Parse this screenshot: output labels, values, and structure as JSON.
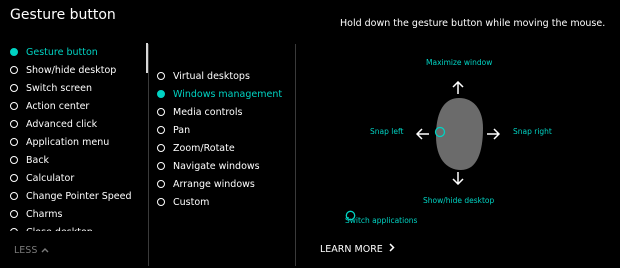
{
  "header": {
    "title": "Gesture button",
    "instruction": "Hold down the gesture button while moving the mouse."
  },
  "left_list": {
    "items": [
      {
        "label": "Gesture button",
        "active": true
      },
      {
        "label": "Show/hide desktop",
        "active": false
      },
      {
        "label": "Switch screen",
        "active": false
      },
      {
        "label": "Action center",
        "active": false
      },
      {
        "label": "Advanced click",
        "active": false
      },
      {
        "label": "Application menu",
        "active": false
      },
      {
        "label": "Back",
        "active": false
      },
      {
        "label": "Calculator",
        "active": false
      },
      {
        "label": "Change Pointer Speed",
        "active": false
      },
      {
        "label": "Charms",
        "active": false
      },
      {
        "label": "Close desktop",
        "active": false
      }
    ]
  },
  "mode_list": {
    "items": [
      {
        "label": "Virtual desktops",
        "active": false
      },
      {
        "label": "Windows management",
        "active": true
      },
      {
        "label": "Media controls",
        "active": false
      },
      {
        "label": "Pan",
        "active": false
      },
      {
        "label": "Zoom/Rotate",
        "active": false
      },
      {
        "label": "Navigate windows",
        "active": false
      },
      {
        "label": "Arrange windows",
        "active": false
      },
      {
        "label": "Custom",
        "active": false
      }
    ]
  },
  "gesture_labels": {
    "up": "Maximize window",
    "left": "Snap left",
    "right": "Snap right",
    "down": "Show/hide desktop",
    "click": "Switch applications"
  },
  "footer": {
    "less_label": "LESS",
    "learn_more_label": "LEARN MORE"
  },
  "colors": {
    "accent": "#00d3c3",
    "background": "#000000",
    "mouse_body": "#6b6b6b"
  },
  "icons": {
    "less": "chevron-up-icon",
    "learn_more": "chevron-right-icon",
    "arrows": [
      "arrow-up-icon",
      "arrow-left-icon",
      "arrow-right-icon",
      "arrow-down-icon"
    ]
  }
}
